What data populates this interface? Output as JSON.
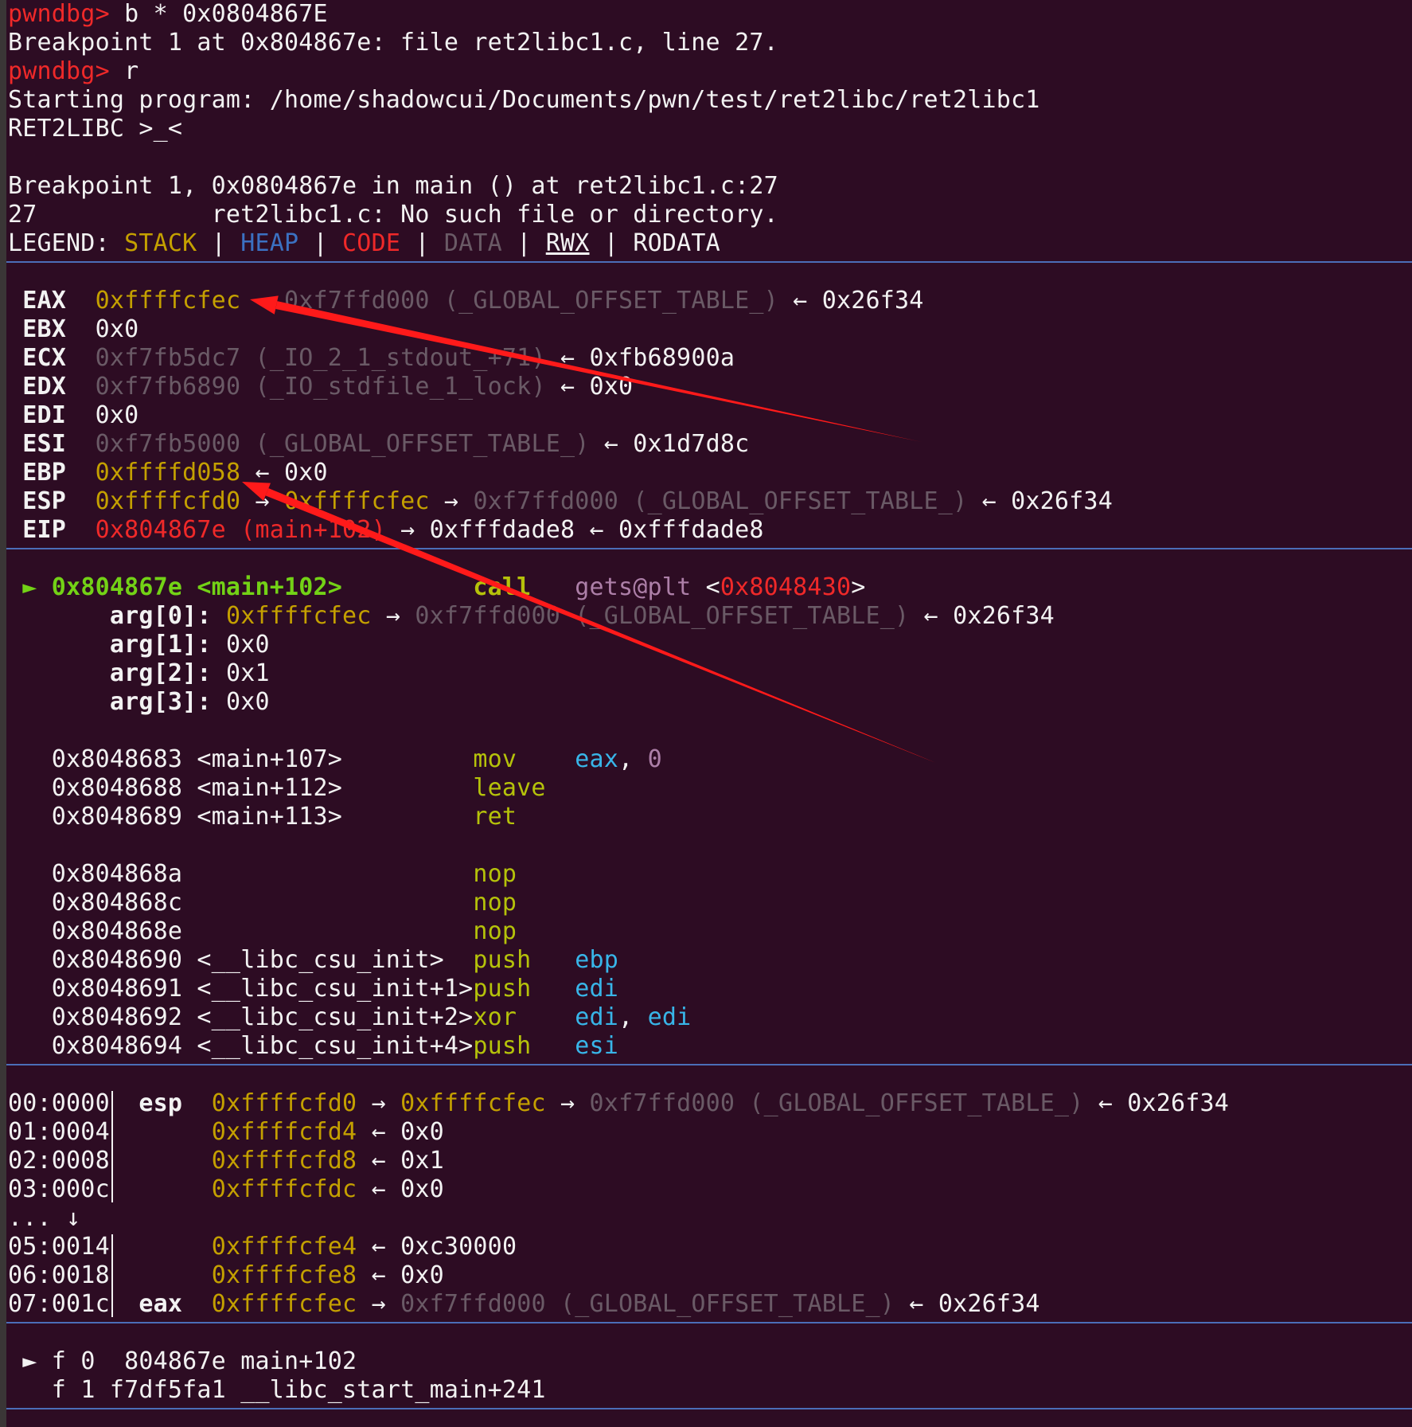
{
  "colors": {
    "background": "#2d0c23",
    "prompt": "#ef2929",
    "stack": "#c4a000",
    "heap": "#3b71c2",
    "code": "#ef2929",
    "data": "#6a5a66",
    "separator": "#4b6eb8",
    "current": "#73d216",
    "mnemonic": "#b5c20a",
    "register_operand": "#38b5e8",
    "immediate": "#ad7fa8",
    "annotation_arrow": "#ff1a1a"
  },
  "icons": {
    "arrow_right": "→",
    "arrow_left": "←",
    "current_marker": "►",
    "down_arrow": "↓"
  },
  "session": [
    {
      "prompt": "pwndbg>",
      "cmd": " b * 0x0804867E"
    },
    {
      "text": "Breakpoint 1 at 0x804867e: file ret2libc1.c, line 27."
    },
    {
      "prompt": "pwndbg>",
      "cmd": " r"
    },
    {
      "text": "Starting program: /home/shadowcui/Documents/pwn/test/ret2libc/ret2libc1"
    },
    {
      "text": "RET2LIBC >_<"
    },
    {
      "text": ""
    },
    {
      "text": "Breakpoint 1, 0x0804867e in main () at ret2libc1.c:27"
    },
    {
      "text": "27\t      ret2libc1.c: No such file or directory."
    }
  ],
  "legend": {
    "label": "LEGEND: ",
    "stack": "STACK",
    "heap": "HEAP",
    "code": "CODE",
    "data": "DATA",
    "rwx": "RWX",
    "rodata": "RODATA",
    "sep": " | "
  },
  "registers": [
    {
      "name": "EAX",
      "val": "0xffffcfec",
      "rest": [
        {
          "s": " → ",
          "c": "g"
        },
        {
          "s": "0xf7ffd000 (_GLOBAL_OFFSET_TABLE_)",
          "c": "g"
        },
        {
          "s": " ← 0x26f34",
          "c": "w"
        }
      ]
    },
    {
      "name": "EBX",
      "val": "0x0",
      "vc": "w",
      "rest": []
    },
    {
      "name": "ECX",
      "val": "0xf7fb5dc7 (_IO_2_1_stdout_+71)",
      "vc": "g",
      "rest": [
        {
          "s": " ← 0xfb68900a",
          "c": "w"
        }
      ]
    },
    {
      "name": "EDX",
      "val": "0xf7fb6890 (_IO_stdfile_1_lock)",
      "vc": "g",
      "rest": [
        {
          "s": " ← 0x0",
          "c": "w"
        }
      ]
    },
    {
      "name": "EDI",
      "val": "0x0",
      "vc": "w",
      "rest": []
    },
    {
      "name": "ESI",
      "val": "0xf7fb5000 (_GLOBAL_OFFSET_TABLE_)",
      "vc": "g",
      "rest": [
        {
          "s": " ← 0x1d7d8c",
          "c": "w"
        }
      ]
    },
    {
      "name": "EBP",
      "val": "0xffffd058",
      "rest": [
        {
          "s": " ← 0x0",
          "c": "w"
        }
      ]
    },
    {
      "name": "ESP",
      "val": "0xffffcfd0",
      "rest": [
        {
          "s": " → ",
          "c": "w"
        },
        {
          "s": "0xffffcfec",
          "c": "y"
        },
        {
          "s": " → ",
          "c": "w"
        },
        {
          "s": "0xf7ffd000 (_GLOBAL_OFFSET_TABLE_)",
          "c": "g"
        },
        {
          "s": " ← 0x26f34",
          "c": "w"
        }
      ]
    },
    {
      "name": "EIP",
      "val": "0x804867e (main+102)",
      "vc": "r",
      "rest": [
        {
          "s": " → 0xfffdade8 ← 0xfffdade8",
          "c": "w"
        }
      ]
    }
  ],
  "current_instr": {
    "marker": "►",
    "addr": "0x804867e <main+102>",
    "mnem": "call",
    "target": "gets@plt",
    "lt": " <",
    "target_addr": "0x8048430",
    "gt": ">"
  },
  "args": [
    {
      "label": "arg[0]:",
      "rest": [
        {
          "s": "0xffffcfec",
          "c": "y"
        },
        {
          "s": " → ",
          "c": "w"
        },
        {
          "s": "0xf7ffd000 (_GLOBAL_OFFSET_TABLE_)",
          "c": "g"
        },
        {
          "s": " ← 0x26f34",
          "c": "w"
        }
      ]
    },
    {
      "label": "arg[1]:",
      "rest": [
        {
          "s": "0x0",
          "c": "w"
        }
      ]
    },
    {
      "label": "arg[2]:",
      "rest": [
        {
          "s": "0x1",
          "c": "w"
        }
      ]
    },
    {
      "label": "arg[3]:",
      "rest": [
        {
          "s": "0x0",
          "c": "w"
        }
      ]
    }
  ],
  "disasm": [
    {
      "addr": "0x8048683 <main+107>",
      "mnem": "mov",
      "ops": [
        {
          "s": "eax",
          "c": "c"
        },
        {
          "s": ", ",
          "c": "w"
        },
        {
          "s": "0",
          "c": "p"
        }
      ]
    },
    {
      "addr": "0x8048688 <main+112>",
      "mnem": "leave",
      "ops": []
    },
    {
      "addr": "0x8048689 <main+113>",
      "mnem": "ret",
      "ops": []
    },
    {
      "addr": "",
      "mnem": "",
      "ops": []
    },
    {
      "addr": "0x804868a",
      "mnem": "nop",
      "ops": []
    },
    {
      "addr": "0x804868c",
      "mnem": "nop",
      "ops": []
    },
    {
      "addr": "0x804868e",
      "mnem": "nop",
      "ops": []
    },
    {
      "addr": "0x8048690 <__libc_csu_init>",
      "mnem": "push",
      "ops": [
        {
          "s": "ebp",
          "c": "c"
        }
      ]
    },
    {
      "addr": "0x8048691 <__libc_csu_init+1>",
      "mnem": "push",
      "ops": [
        {
          "s": "edi",
          "c": "c"
        }
      ]
    },
    {
      "addr": "0x8048692 <__libc_csu_init+2>",
      "mnem": "xor",
      "ops": [
        {
          "s": "edi",
          "c": "c"
        },
        {
          "s": ", ",
          "c": "w"
        },
        {
          "s": "edi",
          "c": "c"
        }
      ]
    },
    {
      "addr": "0x8048694 <__libc_csu_init+4>",
      "mnem": "push",
      "ops": [
        {
          "s": "esi",
          "c": "c"
        }
      ]
    }
  ],
  "stack": [
    {
      "off": "00:0000",
      "bar": true,
      "reg": "esp",
      "addr": "0xffffcfd0",
      "rest": [
        {
          "s": " → ",
          "c": "w"
        },
        {
          "s": "0xffffcfec",
          "c": "y"
        },
        {
          "s": " → ",
          "c": "w"
        },
        {
          "s": "0xf7ffd000 (_GLOBAL_OFFSET_TABLE_)",
          "c": "g"
        },
        {
          "s": " ← 0x26f34",
          "c": "w"
        }
      ]
    },
    {
      "off": "01:0004",
      "bar": true,
      "reg": "",
      "addr": "0xffffcfd4",
      "rest": [
        {
          "s": " ← 0x0",
          "c": "w"
        }
      ]
    },
    {
      "off": "02:0008",
      "bar": true,
      "reg": "",
      "addr": "0xffffcfd8",
      "rest": [
        {
          "s": " ← 0x1",
          "c": "w"
        }
      ]
    },
    {
      "off": "03:000c",
      "bar": true,
      "reg": "",
      "addr": "0xffffcfdc",
      "rest": [
        {
          "s": " ← 0x0",
          "c": "w"
        }
      ]
    },
    {
      "off": "... ↓",
      "bar": false,
      "reg": "",
      "addr": "",
      "rest": []
    },
    {
      "off": "05:0014",
      "bar": true,
      "reg": "",
      "addr": "0xffffcfe4",
      "rest": [
        {
          "s": " ← 0xc30000",
          "c": "w"
        }
      ]
    },
    {
      "off": "06:0018",
      "bar": true,
      "reg": "",
      "addr": "0xffffcfe8",
      "rest": [
        {
          "s": " ← 0x0",
          "c": "w"
        }
      ]
    },
    {
      "off": "07:001c",
      "bar": true,
      "reg": "eax",
      "addr": "0xffffcfec",
      "rest": [
        {
          "s": " → ",
          "c": "w"
        },
        {
          "s": "0xf7ffd000 (_GLOBAL_OFFSET_TABLE_)",
          "c": "g"
        },
        {
          "s": " ← 0x26f34",
          "c": "w"
        }
      ]
    }
  ],
  "backtrace": [
    {
      "marker": "►",
      "text": "f 0  804867e main+102"
    },
    {
      "marker": "",
      "text": "f 1 f7df5fa1 __libc_start_main+241"
    }
  ]
}
